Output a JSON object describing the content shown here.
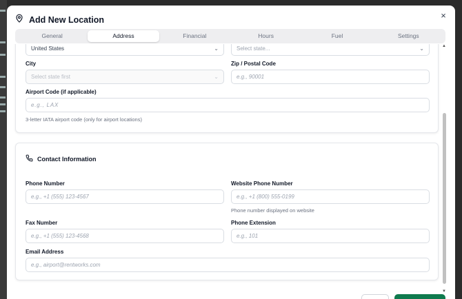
{
  "modal": {
    "title": "Add New Location",
    "close_label": "×"
  },
  "tabs": [
    {
      "label": "General"
    },
    {
      "label": "Address",
      "active": true
    },
    {
      "label": "Financial"
    },
    {
      "label": "Hours"
    },
    {
      "label": "Fuel"
    },
    {
      "label": "Settings"
    }
  ],
  "address": {
    "country_value": "United States",
    "state_placeholder": "Select state...",
    "city_label": "City",
    "city_placeholder": "Select state first",
    "zip_label": "Zip / Postal Code",
    "zip_placeholder": "e.g., 90001",
    "airport_label": "Airport Code (if applicable)",
    "airport_placeholder": "e.g., LAX",
    "airport_help": "3-letter IATA airport code (only for airport locations)"
  },
  "contact": {
    "section_title": "Contact Information",
    "phone_label": "Phone Number",
    "phone_placeholder": "e.g., +1 (555) 123-4567",
    "website_phone_label": "Website Phone Number",
    "website_phone_placeholder": "e.g., +1 (800) 555-0199",
    "website_phone_help": "Phone number displayed on website",
    "fax_label": "Fax Number",
    "fax_placeholder": "e.g., +1 (555) 123-4568",
    "extension_label": "Phone Extension",
    "extension_placeholder": "e.g., 101",
    "email_label": "Email Address",
    "email_placeholder": "e.g., airport@rentworks.com"
  },
  "colors": {
    "primary_button": "#0f7a4e",
    "tab_bg": "#eeeef0"
  },
  "icons": {
    "title_icon": "map-pin-icon",
    "contact_icon": "phone-icon",
    "dropdown_icon": "chevron-down-icon"
  }
}
